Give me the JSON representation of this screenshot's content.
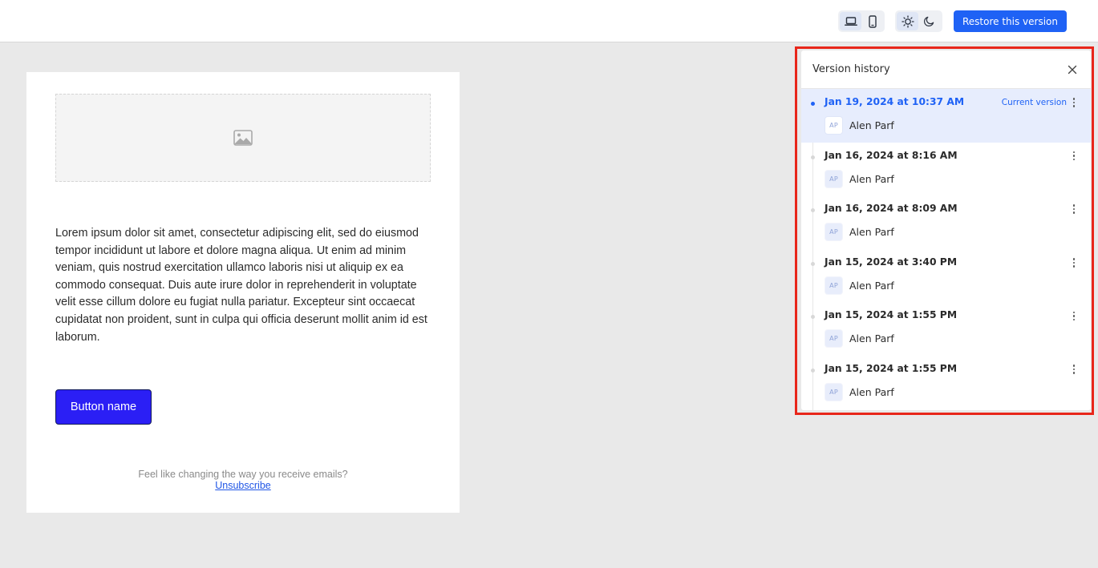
{
  "toolbar": {
    "device_toggle": {
      "options": [
        "desktop-icon",
        "mobile-icon"
      ],
      "selected": "desktop"
    },
    "theme_toggle": {
      "options": [
        "sun-icon",
        "moon-icon"
      ],
      "selected": "light"
    },
    "restore_label": "Restore this version",
    "accent_color": "#1f62f5"
  },
  "email": {
    "image_placeholder_icon": "image-icon",
    "body_text": "Lorem ipsum dolor sit amet, consectetur adipiscing elit, sed do eiusmod tempor incididunt ut labore et dolore magna aliqua. Ut enim ad minim veniam, quis nostrud exercitation ullamco laboris nisi ut aliquip ex ea commodo consequat. Duis aute irure dolor in reprehenderit in voluptate velit esse cillum dolore eu fugiat nulla pariatur. Excepteur sint occaecat cupidatat non proident, sunt in culpa qui officia deserunt mollit anim id est laborum.",
    "button_label": "Button name",
    "button_color": "#2b1ff5",
    "footer_text": "Feel like changing the way you receive emails?",
    "unsubscribe_label": "Unsubscribe"
  },
  "version_history": {
    "title": "Version history",
    "current_label": "Current version",
    "items": [
      {
        "date": "Jan 19, 2024 at 10:37 AM",
        "author_initials": "AP",
        "author": "Alen Parf",
        "current": true
      },
      {
        "date": "Jan 16, 2024 at 8:16 AM",
        "author_initials": "AP",
        "author": "Alen Parf",
        "current": false
      },
      {
        "date": "Jan 16, 2024 at 8:09 AM",
        "author_initials": "AP",
        "author": "Alen Parf",
        "current": false
      },
      {
        "date": "Jan 15, 2024 at 3:40 PM",
        "author_initials": "AP",
        "author": "Alen Parf",
        "current": false
      },
      {
        "date": "Jan 15, 2024 at 1:55 PM",
        "author_initials": "AP",
        "author": "Alen Parf",
        "current": false
      },
      {
        "date": "Jan 15, 2024 at 1:55 PM",
        "author_initials": "AP",
        "author": "Alen Parf",
        "current": false
      }
    ]
  }
}
